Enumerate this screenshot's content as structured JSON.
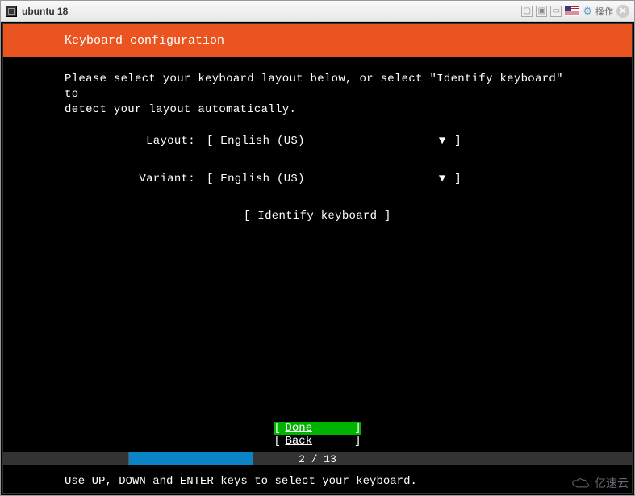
{
  "window": {
    "title": "ubuntu 18",
    "action_label": "操作"
  },
  "installer": {
    "header": "Keyboard configuration",
    "instruction": "Please select your keyboard layout below, or select \"Identify keyboard\" to\ndetect your layout automatically.",
    "fields": {
      "layout": {
        "label": "Layout:",
        "value": "English (US)"
      },
      "variant": {
        "label": "Variant:",
        "value": "English (US)"
      }
    },
    "identify_button": "Identify keyboard",
    "buttons": {
      "done": "Done",
      "back": "Back"
    },
    "progress": {
      "current": 2,
      "total": 13,
      "text": "2 / 13"
    },
    "hint": "Use UP, DOWN and ENTER keys to select your keyboard."
  },
  "watermark": "亿速云"
}
